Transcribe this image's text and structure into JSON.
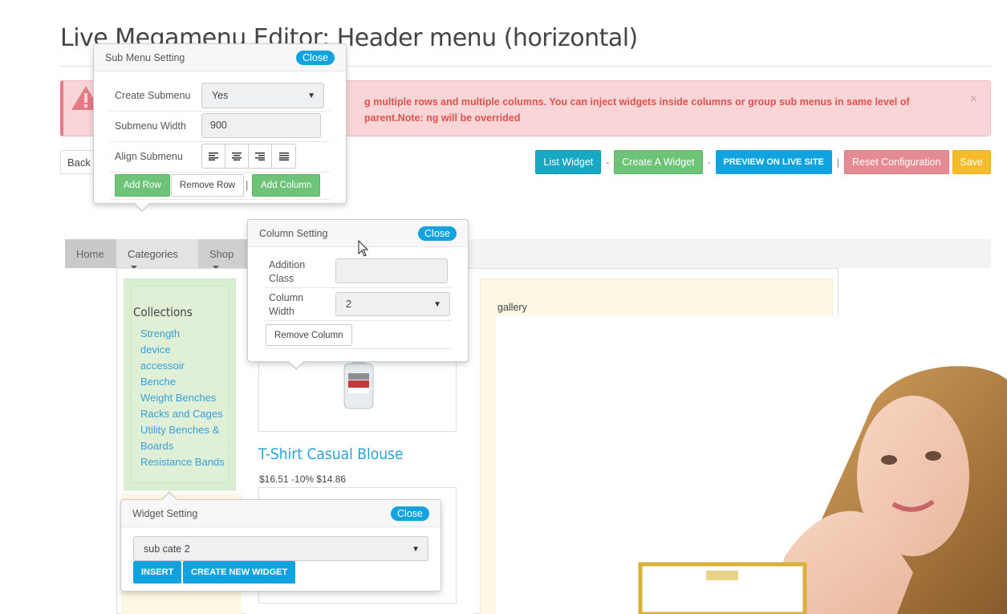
{
  "page": {
    "title": "Live Megamenu Editor: Header menu (horizontal)"
  },
  "alert": {
    "text": "g multiple rows and multiple columns. You can inject widgets inside columns or group sub menus in same level of parent.Note: ng will be overrided",
    "close": "×"
  },
  "toolbar": {
    "back_label": "Back",
    "list_widget": "List Widget",
    "create_widget": "Create A Widget",
    "preview": "PREVIEW ON LIVE SITE",
    "reset": "Reset Configuration",
    "save": "Save",
    "sep_dash": "-",
    "sep_pipe": "|"
  },
  "nav": {
    "items": [
      {
        "label": "Home"
      },
      {
        "label": "Categories"
      },
      {
        "label": "Shop"
      }
    ]
  },
  "collections": {
    "title": "Collections",
    "links": [
      "Strength",
      "device",
      "accessoir",
      "Benche",
      "Weight Benches",
      "Racks and Cages",
      "Utility Benches &",
      "Boards",
      "Resistance Bands"
    ]
  },
  "gallery": {
    "label": "gallery"
  },
  "product": {
    "name": "T-Shirt Casual Blouse",
    "price": "$16.51 -10% $14.86"
  },
  "submenu_popover": {
    "title": "Sub Menu Setting",
    "close": "Close",
    "create_label": "Create Submenu",
    "create_value": "Yes",
    "width_label": "Submenu Width",
    "width_value": "900",
    "align_label": "Align Submenu",
    "add_row": "Add Row",
    "remove_row": "Remove Row",
    "separator": "|",
    "add_column": "Add Column"
  },
  "column_popover": {
    "title": "Column Setting",
    "close": "Close",
    "class_label_1": "Addition",
    "class_label_2": "Class",
    "class_value": "",
    "width_label_1": "Column",
    "width_label_2": "Width",
    "width_value": "2",
    "remove_column": "Remove Column"
  },
  "widget_popover": {
    "title": "Widget Setting",
    "close": "Close",
    "select_value": "sub cate 2",
    "insert": "INSERT",
    "create_new": "CREATE NEW WIDGET"
  },
  "colors": {
    "accent_blue": "#10a3e0",
    "success_green": "#6dc378",
    "danger_red": "#d9534f",
    "warning_yellow": "#f5bc2c",
    "info": "#17a8c4"
  }
}
